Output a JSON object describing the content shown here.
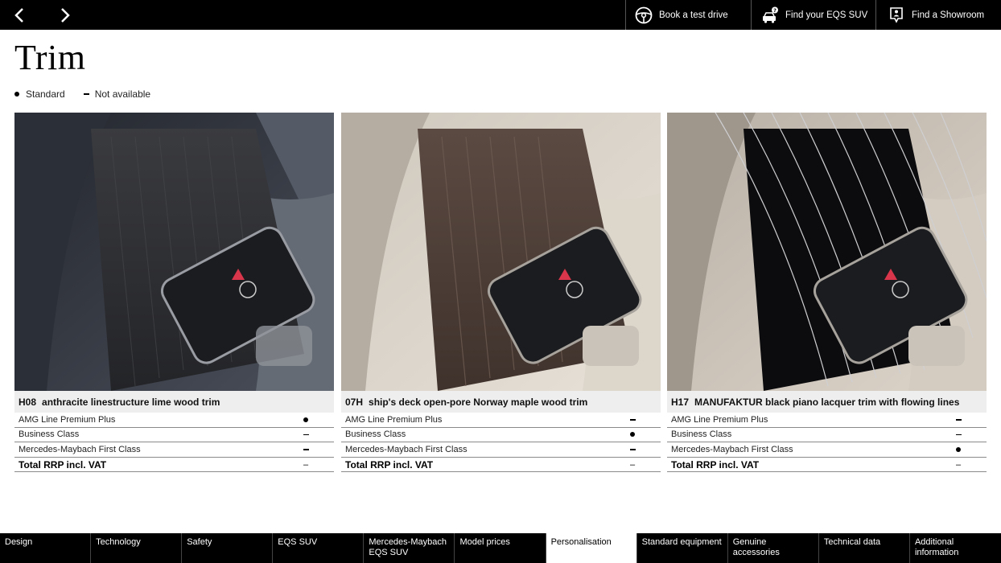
{
  "topbar": {
    "prev_icon": "chevron-left-icon",
    "next_icon": "chevron-right-icon",
    "actions": [
      {
        "label": "Book a test drive",
        "icon": "steering-wheel-icon"
      },
      {
        "label": "Find your EQS SUV",
        "icon": "car-question-icon"
      },
      {
        "label": "Find a Showroom",
        "icon": "location-pin-icon"
      }
    ]
  },
  "page": {
    "title": "Trim"
  },
  "legend": {
    "standard": "Standard",
    "not_available": "Not available"
  },
  "cards": [
    {
      "code": "H08",
      "name": "anthracite linestructure lime wood trim",
      "rows": [
        {
          "label": "AMG Line Premium Plus",
          "mark": "dot"
        },
        {
          "label": "Business Class",
          "mark": "dash"
        },
        {
          "label": "Mercedes-Maybach First Class",
          "mark": "dash"
        }
      ],
      "total_label": "Total RRP incl. VAT",
      "total_value": "–"
    },
    {
      "code": "07H",
      "name": "ship's deck open-pore Norway maple wood trim",
      "rows": [
        {
          "label": "AMG Line Premium Plus",
          "mark": "dash"
        },
        {
          "label": "Business Class",
          "mark": "dot"
        },
        {
          "label": "Mercedes-Maybach First Class",
          "mark": "dash"
        }
      ],
      "total_label": "Total RRP incl. VAT",
      "total_value": "–"
    },
    {
      "code": "H17",
      "name": "MANUFAKTUR black piano lacquer trim with flowing lines",
      "rows": [
        {
          "label": "AMG Line Premium Plus",
          "mark": "dash"
        },
        {
          "label": "Business Class",
          "mark": "dash"
        },
        {
          "label": "Mercedes-Maybach First Class",
          "mark": "dot"
        }
      ],
      "total_label": "Total RRP incl. VAT",
      "total_value": "–"
    }
  ],
  "bottomnav": [
    {
      "label": "Design",
      "active": false
    },
    {
      "label": "Technology",
      "active": false
    },
    {
      "label": "Safety",
      "active": false
    },
    {
      "label": "EQS SUV",
      "active": false
    },
    {
      "label": "Mercedes-Maybach EQS SUV",
      "active": false
    },
    {
      "label": "Model prices",
      "active": false
    },
    {
      "label": "Personalisation",
      "active": true
    },
    {
      "label": "Standard equipment",
      "active": false
    },
    {
      "label": "Genuine accessories",
      "active": false
    },
    {
      "label": "Technical data",
      "active": false
    },
    {
      "label": "Additional information",
      "active": false
    }
  ],
  "colors": {
    "topbar_bg": "#000000",
    "caption_bg": "#eeeeee",
    "card1_trim": "#2e2f33",
    "card2_trim": "#4a3a33",
    "card3_trim": "#0c0c0e"
  }
}
